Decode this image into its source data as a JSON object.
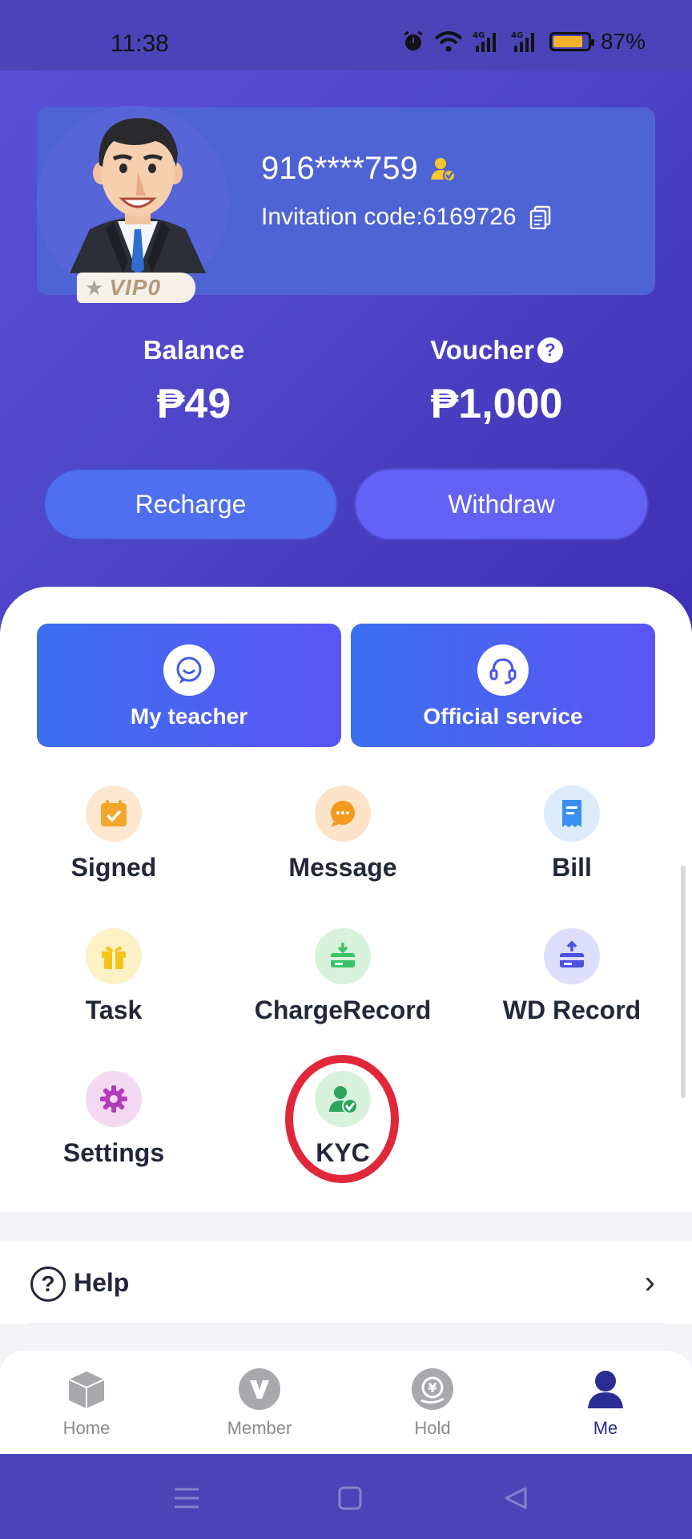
{
  "status_bar": {
    "time": "11:38",
    "battery": "87%",
    "battery_level": 0.87,
    "network1": "4G",
    "network2": "4G"
  },
  "profile": {
    "phone": "916****759",
    "invitation_code": "Invitation code:6169726",
    "vip_label": "VIP0"
  },
  "balance": {
    "label": "Balance",
    "value": "₱49"
  },
  "voucher": {
    "label": "Voucher",
    "value": "₱1,000",
    "help_icon": "?"
  },
  "buttons": {
    "recharge": "Recharge",
    "withdraw": "Withdraw"
  },
  "cards": {
    "teacher": "My teacher",
    "service": "Official service"
  },
  "grid": {
    "signed": "Signed",
    "message": "Message",
    "bill": "Bill",
    "task": "Task",
    "charge_record": "ChargeRecord",
    "wd_record": "WD Record",
    "settings": "Settings",
    "kyc": "KYC"
  },
  "help": {
    "label": "Help",
    "icon": "?"
  },
  "bottom_nav": {
    "home": "Home",
    "member": "Member",
    "hold": "Hold",
    "me": "Me"
  },
  "colors": {
    "hero": "#4f47c9",
    "accent": "#5b55f5",
    "highlight_circle": "#e0283a",
    "active_nav": "#2b2d92"
  }
}
